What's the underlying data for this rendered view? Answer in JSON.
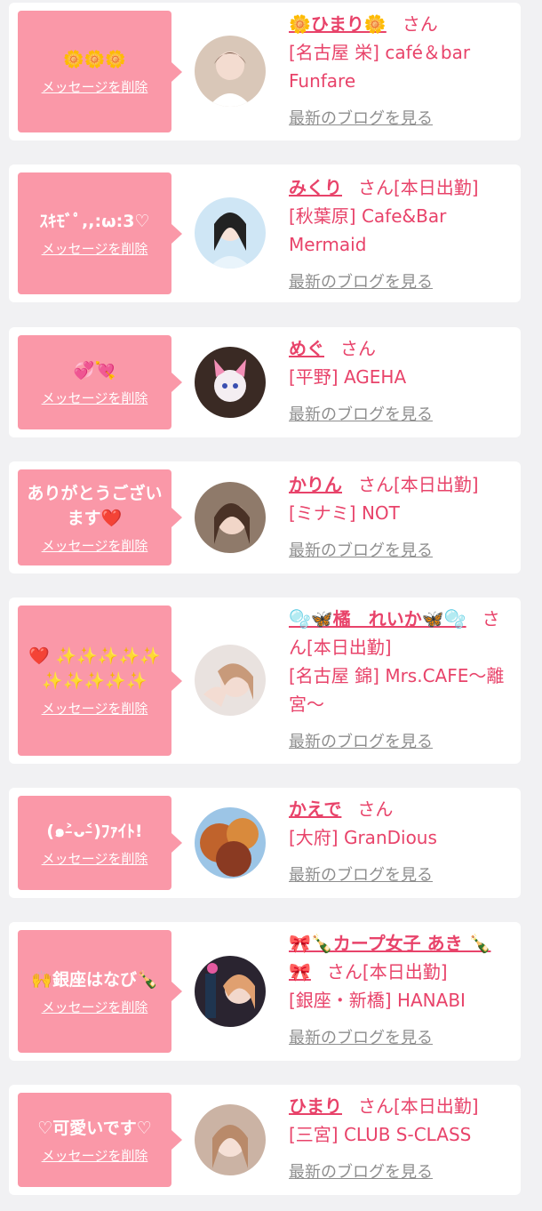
{
  "cards": [
    {
      "message": "🌼🌼🌼",
      "delete_label": "メッセージを削除",
      "name": "🌼ひまり🌼",
      "san": "さん",
      "status": "",
      "shop": "[名古屋 栄] café＆bar Funfare",
      "blog_label": "最新のブログを見る"
    },
    {
      "message": "ｽｷﾓﾞﾟ,,:ω:3♡",
      "delete_label": "メッセージを削除",
      "name": "みくり",
      "san": "さん",
      "status": "[本日出勤]",
      "shop": "[秋葉原] Cafe&Bar Mermaid",
      "blog_label": "最新のブログを見る"
    },
    {
      "message": "💞💘",
      "delete_label": "メッセージを削除",
      "name": "めぐ",
      "san": "さん",
      "status": "",
      "shop": "[平野] AGEHA",
      "blog_label": "最新のブログを見る"
    },
    {
      "message": "ありがとうございます❤️",
      "delete_label": "メッセージを削除",
      "name": "かりん",
      "san": "さん",
      "status": "[本日出勤]",
      "shop": "[ミナミ] NOT",
      "blog_label": "最新のブログを見る"
    },
    {
      "message": "❤️ ✨✨✨✨✨✨✨✨✨✨",
      "delete_label": "メッセージを削除",
      "name": "🫧🦋橘　れいか🦋🫧",
      "san": "さん",
      "status": "[本日出勤]",
      "shop": "[名古屋 錦] Mrs.CAFE～離宮～",
      "blog_label": "最新のブログを見る"
    },
    {
      "message": "(๑˃̵ᴗ˂̵)ﾌｧｲﾄ!",
      "delete_label": "メッセージを削除",
      "name": "かえで",
      "san": "さん",
      "status": "",
      "shop": "[大府] GranDious",
      "blog_label": "最新のブログを見る"
    },
    {
      "message": "🙌銀座はなび🍾",
      "delete_label": "メッセージを削除",
      "name": "🎀🍾カープ女子 あき 🍾🎀",
      "san": "さん",
      "status": "[本日出勤]",
      "shop": "[銀座・新橋] HANABI",
      "blog_label": "最新のブログを見る"
    },
    {
      "message": "♡可愛いです♡",
      "delete_label": "メッセージを削除",
      "name": "ひまり",
      "san": "さん",
      "status": "[本日出勤]",
      "shop": "[三宮] CLUB S-CLASS",
      "blog_label": "最新のブログを見る"
    }
  ],
  "colors": {
    "accent": "#e8436a",
    "bubble": "#fa98a8",
    "card": "#ffffff",
    "background": "#f1f1f3",
    "link_gray": "#8e8e8e"
  },
  "icons": [
    "girl-avatar-photo"
  ]
}
